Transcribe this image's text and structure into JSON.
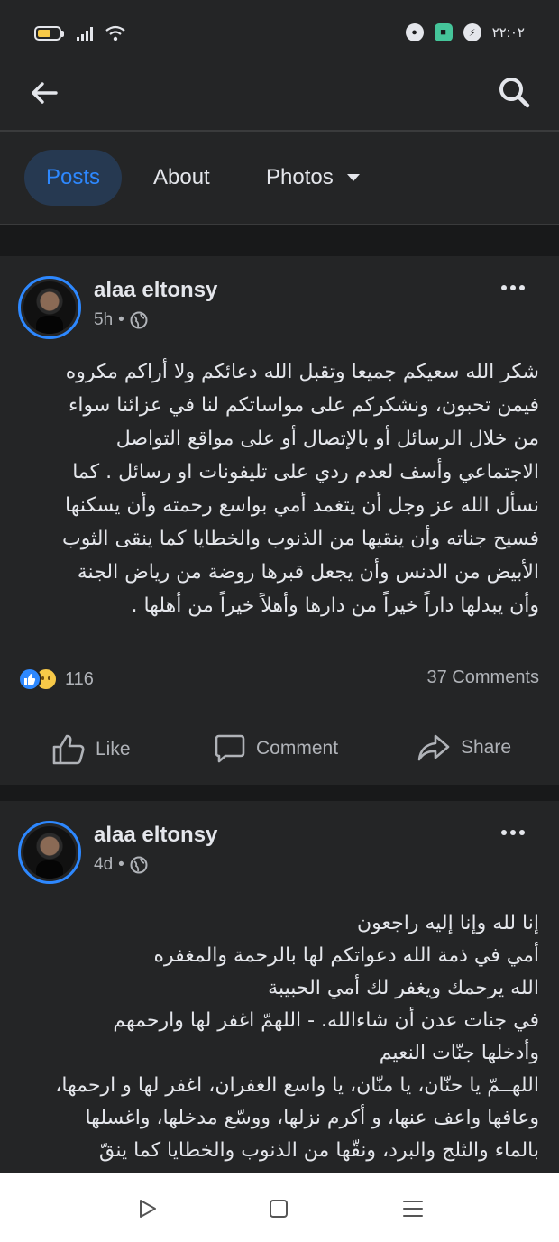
{
  "status_bar": {
    "time": "٢٢:٠٢"
  },
  "tabs": [
    {
      "label": "Posts",
      "active": true
    },
    {
      "label": "About",
      "active": false
    },
    {
      "label": "Photos",
      "active": false
    }
  ],
  "posts": [
    {
      "author": "alaa eltonsy",
      "time": "5h",
      "lines": [
        "شكر الله سعيكم جميعا وتقبل الله دعائكم ولا أراكم مكروه",
        "فيمن تحبون، ونشكركم على مواساتكم لنا في عزائنا سواء",
        "من خلال الرسائل أو بالإتصال أو  على مواقع التواصل",
        "الاجتماعي  وأسف لعدم ردي على تليفونات او رسائل . كما",
        "نسأل الله عز وجل أن يتغمد أمي  بواسع رحمته وأن يسكنها",
        "فسيح جناته وأن ينقيها من الذنوب والخطايا كما ينقى الثوب",
        "الأبيض من الدنس وأن يجعل قبرها روضة من رياض الجنة",
        "وأن يبدلها  داراً خيراً من دارها وأهلاً خيراً من أهلها  ."
      ],
      "reaction_count": "116",
      "comments_label": "37 Comments"
    },
    {
      "author": "alaa eltonsy",
      "time": "4d",
      "lines": [
        "إنا لله وإنا إليه راجعون",
        "أمي في ذمة الله دعواتكم لها بالرحمة والمغفره",
        "الله يرحمك ويغفر لك أمي الحبيبة",
        "في جنات عدن أن شاءالله.    - اللهمّ اغفر لها وارحمهم",
        "وأدخلها جنّات النعيم",
        "اللهــمّ يا حنّان، يا منّان، يا واسع الغفران، اغفر لها و ارحمها،",
        "وعافها واعف عنها، و أكرم نزلها، ووسّع مدخلها، واغسلها",
        "بالماء والثلج والبرد، ونقّها من الذنوب والخطايا كما ينقّ"
      ]
    }
  ],
  "actions": {
    "like": "Like",
    "comment": "Comment",
    "share": "Share"
  },
  "colors": {
    "accent": "#2d88ff",
    "background": "#18191a",
    "card": "#242526"
  }
}
